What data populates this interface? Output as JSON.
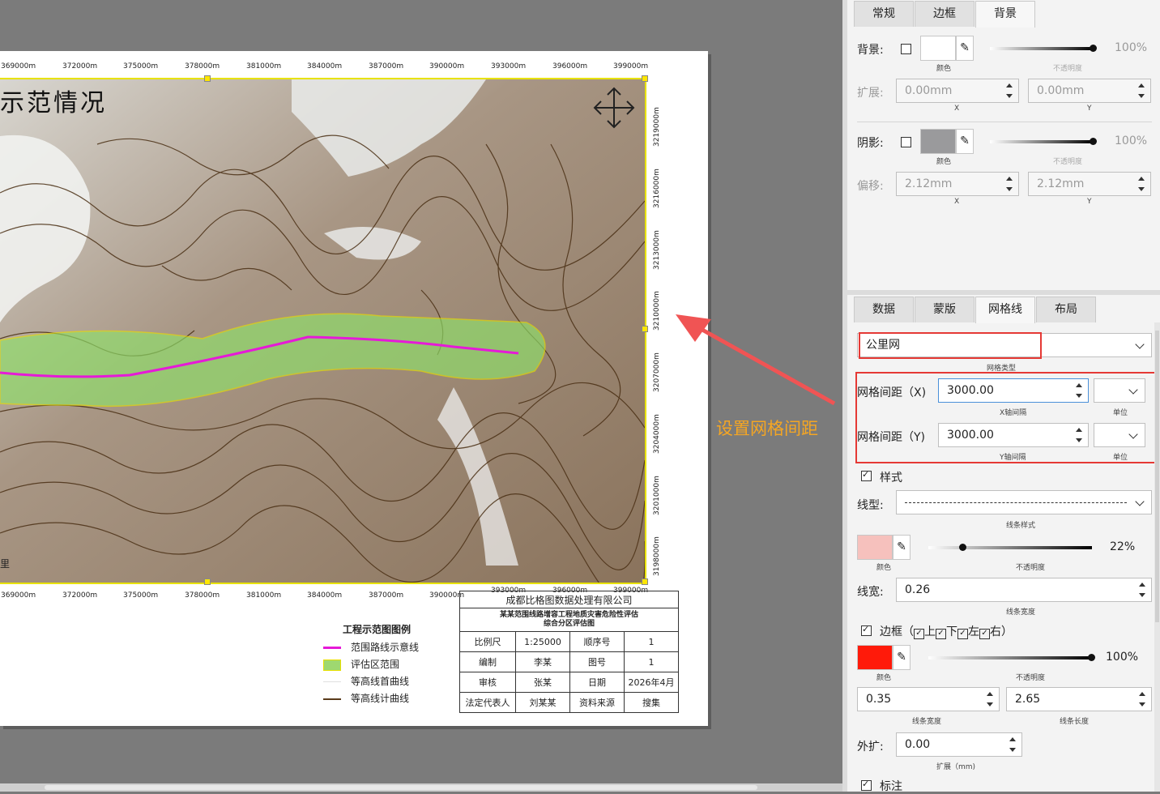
{
  "map": {
    "title_fragment": "示范情况",
    "top_ticks": [
      "369000m",
      "372000m",
      "375000m",
      "378000m",
      "381000m",
      "384000m",
      "387000m",
      "390000m",
      "393000m",
      "396000m",
      "399000m"
    ],
    "bottom_ticks": [
      "369000m",
      "372000m",
      "375000m",
      "378000m",
      "381000m",
      "384000m",
      "387000m",
      "390000m",
      "393000m",
      "396000m",
      "399000m"
    ],
    "right_ticks": [
      "3219000m",
      "3216000m",
      "3213000m",
      "3210000m",
      "3207000m",
      "3204000m",
      "3201000m",
      "3198000m"
    ],
    "scale_fragment": "里"
  },
  "legend": {
    "title": "工程示范图图例",
    "items": [
      {
        "label": "范围路线示意线",
        "color": "#e619d8"
      },
      {
        "label": "评估区范围",
        "color": "#9ed870"
      },
      {
        "label": "等高线首曲线",
        "color": "#e0e0e0"
      },
      {
        "label": "等高线计曲线",
        "color": "#5a3b1b"
      }
    ]
  },
  "info_table": {
    "company": "成都比格图数据处理有限公司",
    "project": "某某范围线路增容工程地质灾害危险性评估",
    "subtitle": "综合分区评估图",
    "rows": [
      [
        "比例尺",
        "1:25000",
        "顺序号",
        "1"
      ],
      [
        "编制",
        "李某",
        "图号",
        "1"
      ],
      [
        "审核",
        "张某",
        "日期",
        "2026年4月"
      ],
      [
        "法定代表人",
        "刘某某",
        "资料来源",
        "搜集"
      ]
    ]
  },
  "annotation": "设置网格间距",
  "panel_top": {
    "tabs": [
      "常规",
      "边框",
      "背景"
    ],
    "active_tab": "背景",
    "background_label": "背景:",
    "color_caption": "颜色",
    "opacity_caption": "不透明度",
    "bg_opacity": "100%",
    "bg_opacity_value": 1.0,
    "expand_label": "扩展:",
    "expand_x": "0.00mm",
    "expand_y": "0.00mm",
    "x_caption": "X",
    "y_caption": "Y",
    "shadow_label": "阴影:",
    "shadow_opacity": "100%",
    "shadow_opacity_value": 1.0,
    "offset_label": "偏移:",
    "offset_x": "2.12mm",
    "offset_y": "2.12mm"
  },
  "panel_bottom": {
    "tabs": [
      "数据",
      "蒙版",
      "网格线",
      "布局"
    ],
    "active_tab": "网格线",
    "grid_type_value": "公里网",
    "grid_type_caption": "网格类型",
    "grid_x_label": "网格间距（X)",
    "grid_x_value": "3000.00",
    "grid_x_caption": "X轴间隔",
    "grid_y_label": "网格间距（Y)",
    "grid_y_value": "3000.00",
    "grid_y_caption": "Y轴间隔",
    "unit_caption": "单位",
    "style_label": "样式",
    "line_type_label": "线型:",
    "line_style_caption": "线条样式",
    "line_color": "#f6c1bd",
    "line_opacity": "22%",
    "line_opacity_value": 0.22,
    "color_caption": "颜色",
    "opacity_caption": "不透明度",
    "line_width_label": "线宽:",
    "line_width_value": "0.26",
    "line_width_caption": "线条宽度",
    "border_label": "边框",
    "border_sides": [
      "上",
      "下",
      "左",
      "右"
    ],
    "border_color": "#ff1a0a",
    "border_opacity": "100%",
    "border_opacity_value": 1.0,
    "border_width_value": "0.35",
    "border_width_caption": "线条宽度",
    "border_length_value": "2.65",
    "border_length_caption": "线条长度",
    "outset_label": "外扩:",
    "outset_value": "0.00",
    "outset_caption": "扩展（mm)",
    "annotation_label": "标注"
  }
}
